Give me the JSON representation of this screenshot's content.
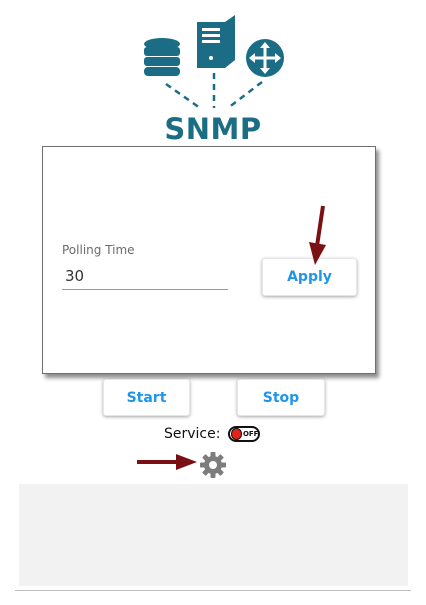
{
  "logo": {
    "text": "SNMP",
    "color": "#1b6d86",
    "icons": [
      "database-icon",
      "server-icon",
      "router-icon"
    ]
  },
  "settings": {
    "polling_label": "Polling Time",
    "polling_value": "30",
    "apply_label": "Apply"
  },
  "controls": {
    "start_label": "Start",
    "stop_label": "Stop"
  },
  "service": {
    "label": "Service:",
    "state": "OFF",
    "status_color": "#e2231a"
  },
  "colors": {
    "accent": "#2196e8",
    "arrow": "#7a1014",
    "bottom_panel": "#f2f2f2"
  }
}
